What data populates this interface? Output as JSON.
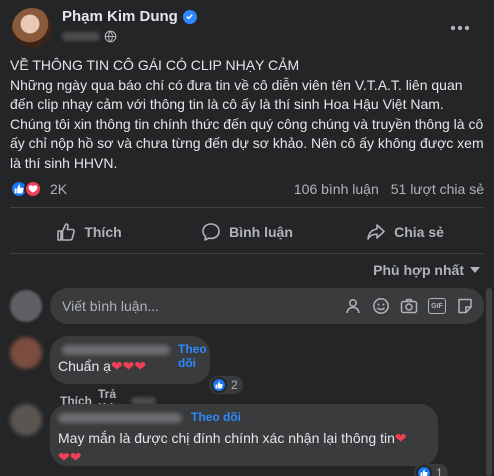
{
  "post": {
    "author": "Phạm Kim Dung",
    "text_lines": [
      "VỀ THÔNG TIN CÔ GÁI CÓ CLIP NHẠY CẢM",
      "Những ngày qua báo chí có đưa tin về cô diễn viên tên V.T.A.T. liên quan đến clip nhạy cảm với thông tin là cô ấy là thí sinh Hoa Hậu Việt Nam. Chúng tôi xin thông tin chính thức đến quý công chúng và truyền thông là cô ấy chỉ nộp hồ sơ và chưa từng đến dự sơ khảo. Nên cô ấy không được xem là thí sinh HHVN."
    ],
    "reaction_count": "2K",
    "comment_count": "106 bình luận",
    "share_count": "51 lượt chia sẻ"
  },
  "actions": {
    "like": "Thích",
    "comment": "Bình luận",
    "share": "Chia sẻ"
  },
  "sort_label": "Phù hợp nhất",
  "composer": {
    "placeholder": "Viết bình luận...",
    "gif_label": "GIF"
  },
  "comments": [
    {
      "follow": "Theo dõi",
      "text": "Chuẩn ạ",
      "hearts": "❤❤❤",
      "likes": "2",
      "like_action": "Thích",
      "reply_action": "Trả lời"
    },
    {
      "follow": "Theo dõi",
      "text": "May mắn là được chị đính chính xác nhận lại thông tin",
      "hearts_inline": "❤",
      "hearts_next": "❤❤",
      "likes": "1"
    }
  ],
  "colors": {
    "background": "#242526",
    "bubble": "#3a3b3c",
    "accent": "#2d88ff",
    "love": "#f33e58"
  }
}
